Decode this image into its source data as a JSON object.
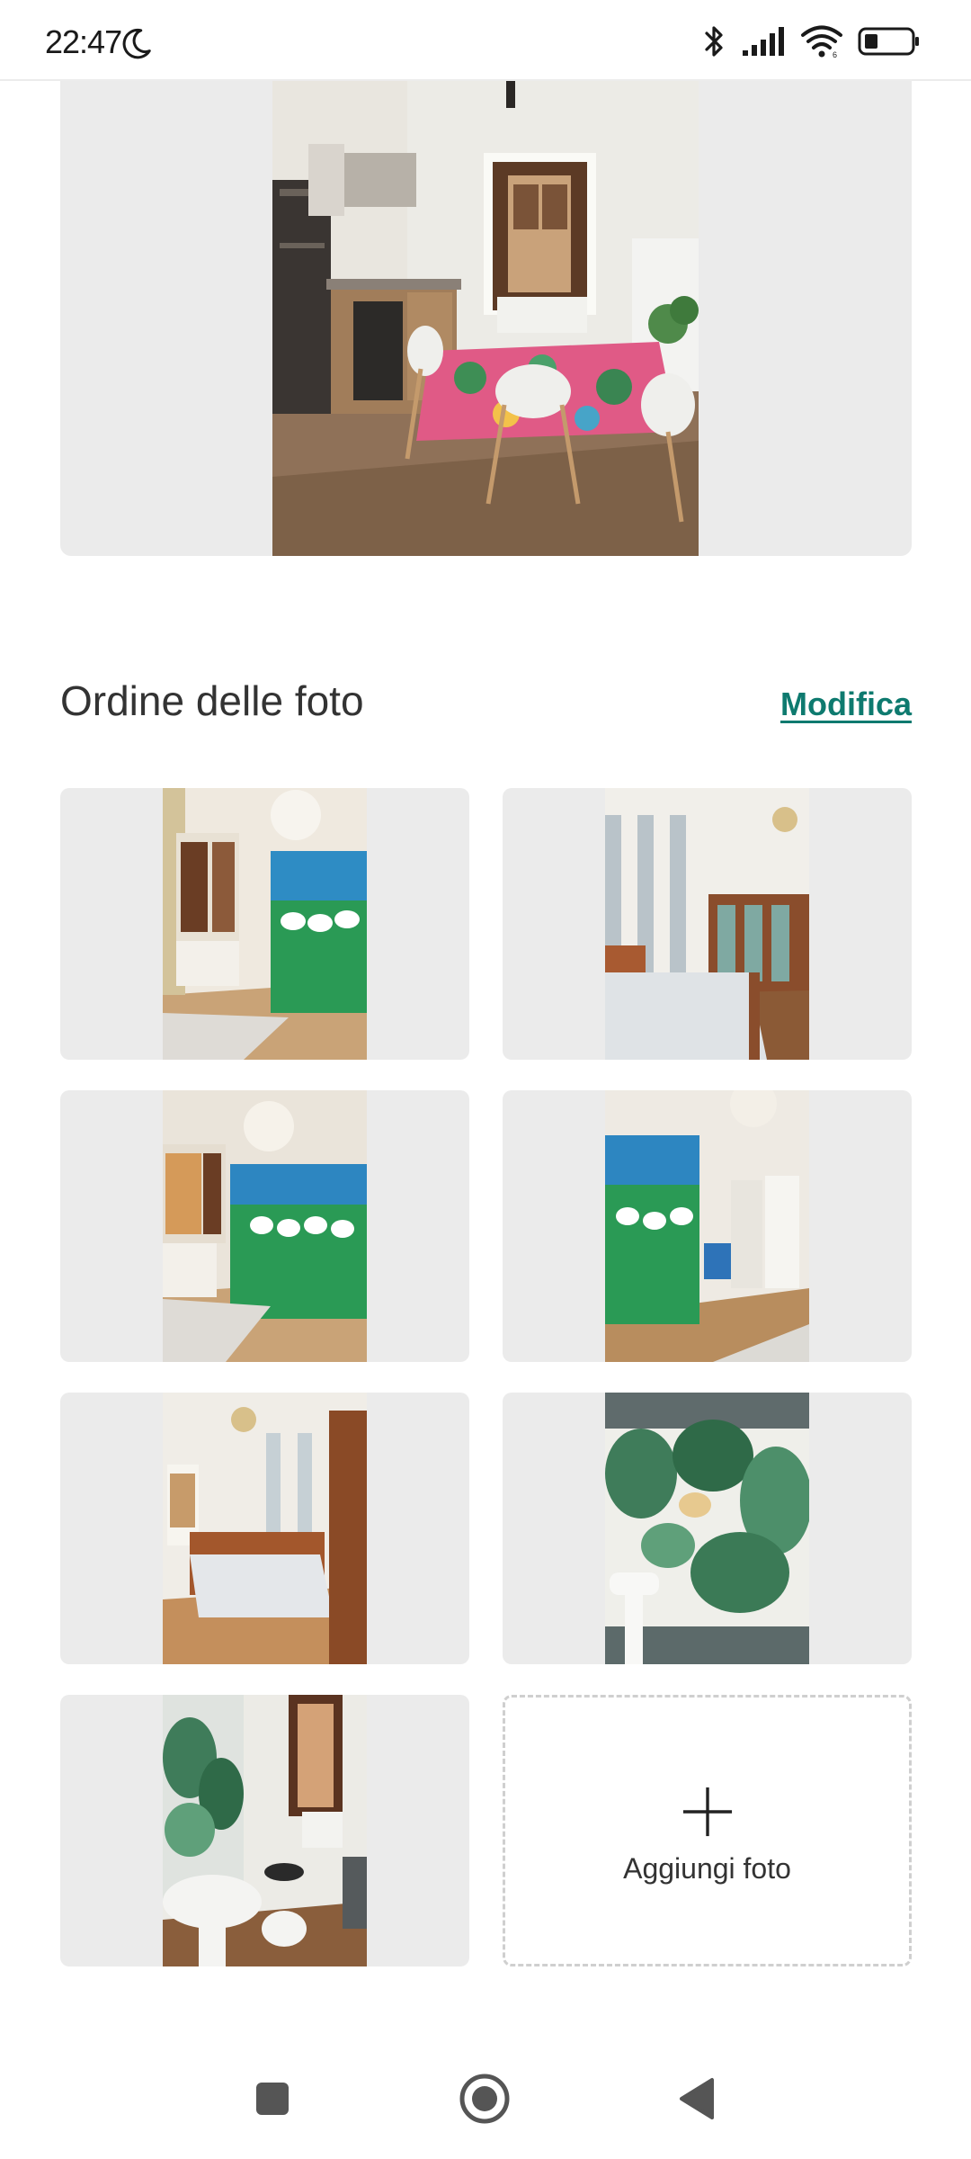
{
  "status_bar": {
    "time": "22:47",
    "icons": [
      "moon-icon",
      "bluetooth-icon",
      "signal-icon",
      "wifi-icon",
      "battery-icon"
    ]
  },
  "hero": {
    "photo": "kitchen-dining-room-photo"
  },
  "section": {
    "title": "Ordine delle foto",
    "edit_label": "Modifica",
    "accent_color": "#0e7a6f"
  },
  "photos": [
    {
      "name": "bedroom-geese-wardrobe-window"
    },
    {
      "name": "bedroom-striped-wall-bed"
    },
    {
      "name": "bedroom-geese-wardrobe-lamp"
    },
    {
      "name": "bedroom-geese-wardrobe-doorway"
    },
    {
      "name": "bedroom-double-bed-chandelier"
    },
    {
      "name": "bathroom-tropical-wallpaper-sink"
    },
    {
      "name": "bathroom-toilet-sink-window"
    }
  ],
  "add_photo": {
    "label": "Aggiungi foto",
    "icon": "plus-icon"
  },
  "nav_bar": {
    "icons": [
      "recents-square-icon",
      "home-circle-icon",
      "back-triangle-icon"
    ]
  }
}
